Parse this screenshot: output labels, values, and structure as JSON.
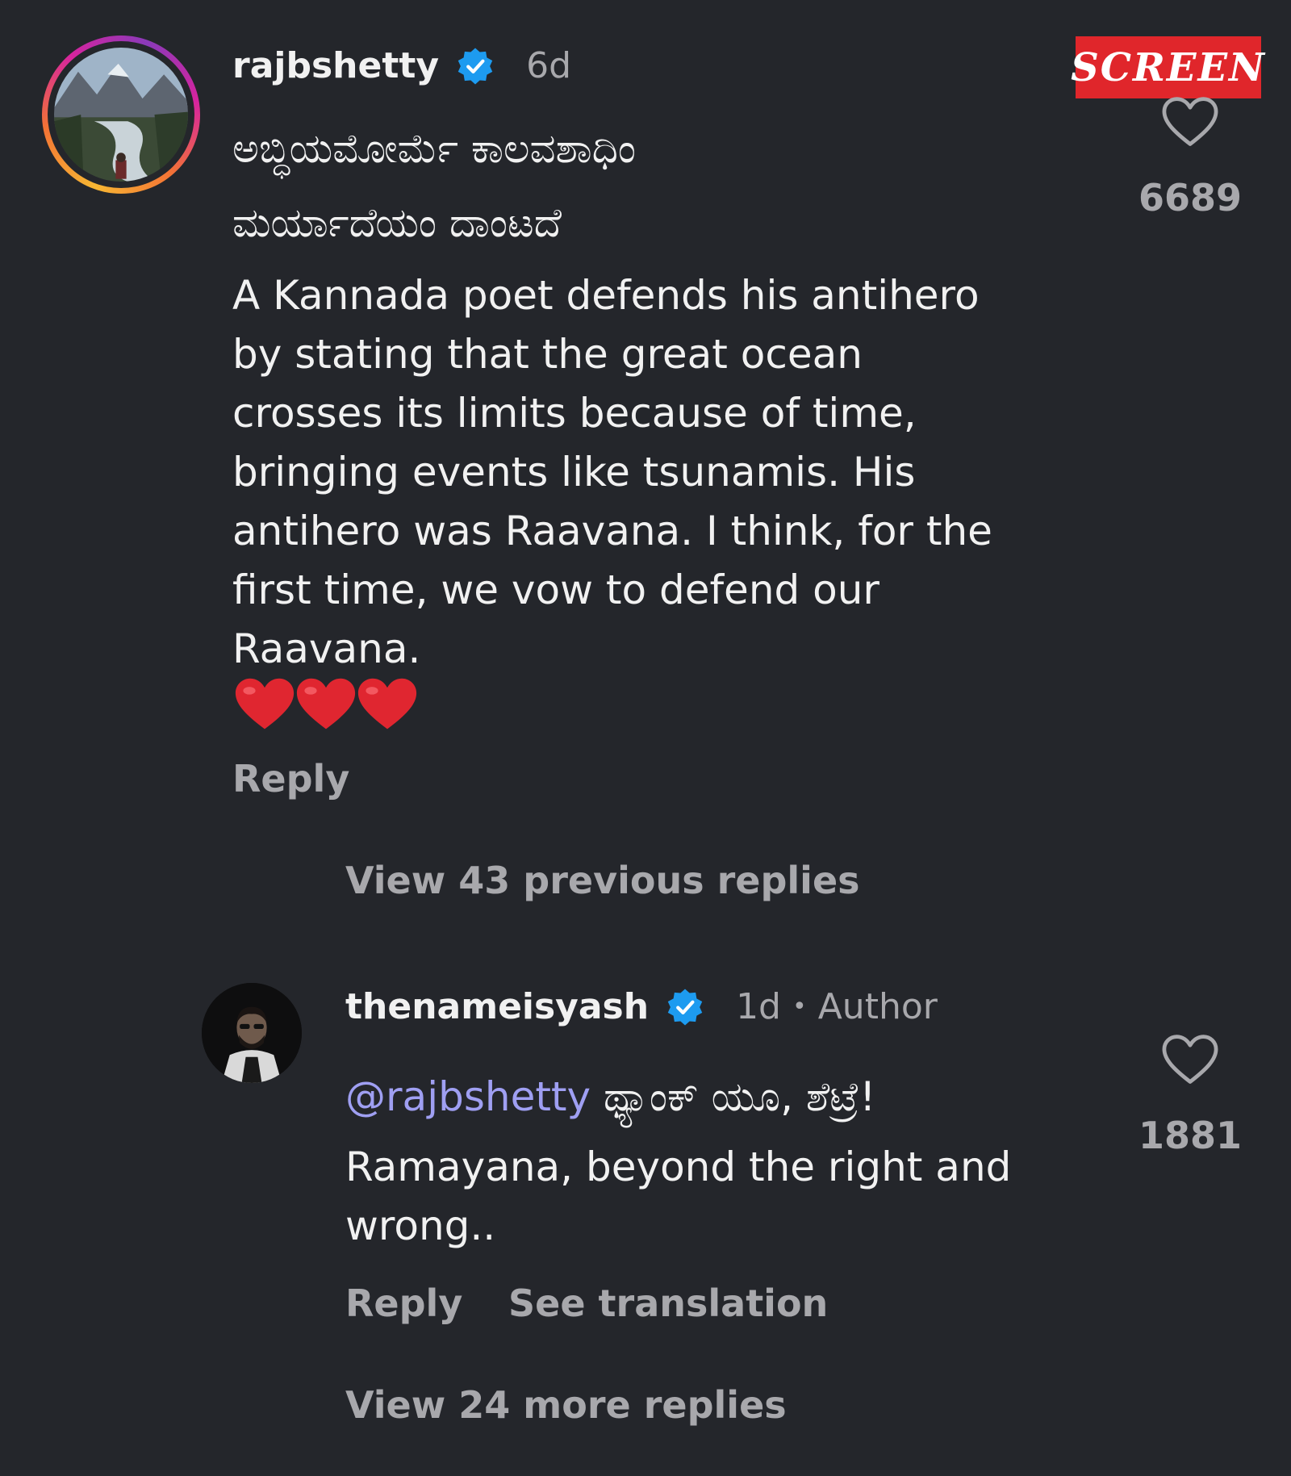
{
  "watermark": {
    "text": "SCREEN"
  },
  "comment": {
    "username": "rajbshetty",
    "time": "6d",
    "kannada_line1": "ಅಬ್ಧಿಯಮೋರ್ಮೆ ಕಾಲವಶಾಧಿಂ",
    "kannada_line2": "ಮರ್ಯಾದೆಯಂ ದಾಂಟದೆ",
    "lines": [
      "A Kannada poet defends his antihero",
      "by stating that the great ocean",
      "crosses its limits because of time,",
      "bringing events like tsunamis. His",
      "antihero was Raavana. I think, for the",
      "first time, we vow to defend our",
      "Raavana."
    ],
    "emoji": "❤️❤️❤️",
    "reply_label": "Reply",
    "like_count": "6689"
  },
  "view_previous": "View 43 previous replies",
  "reply": {
    "username": "thenameisyash",
    "time": "1d",
    "dot": "•",
    "author_label": "Author",
    "mention": "@rajbshetty",
    "kannada_text": " ಥ್ಯಾಂಕ್ ಯೂ, ಶೆಟ್ರೆ!",
    "lines": [
      "Ramayana, beyond the right and",
      "wrong.."
    ],
    "reply_label": "Reply",
    "translate_label": "See translation",
    "like_count": "1881"
  },
  "view_more": "View 24 more replies",
  "colors": {
    "background": "#24262b",
    "verified": "#1d9bf0",
    "mention": "#9f9ff2",
    "muted": "#a8a8ac",
    "watermark": "#e0262b"
  },
  "icons": [
    "verified-badge-icon",
    "heart-outline-icon",
    "red-heart-emoji"
  ]
}
